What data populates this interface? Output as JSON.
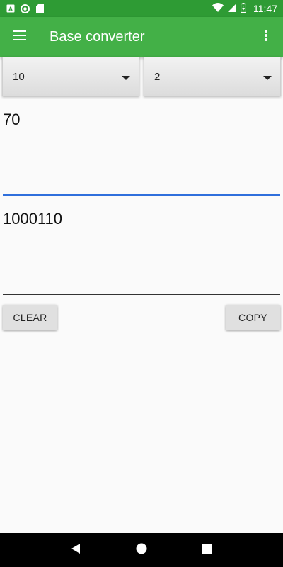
{
  "status_bar": {
    "time": "11:47",
    "left_icons": [
      "a-letter-icon",
      "circle-icon",
      "sd-card-icon"
    ],
    "right_icons": [
      "wifi-icon",
      "cell-signal-icon",
      "battery-icon"
    ]
  },
  "app_bar": {
    "title": "Base converter",
    "menu_icon": "hamburger-icon",
    "overflow_icon": "more-vert-icon"
  },
  "spinners": {
    "from_base": "10",
    "to_base": "2"
  },
  "fields": {
    "input_value": "70",
    "output_value": "1000110"
  },
  "buttons": {
    "clear_label": "CLEAR",
    "copy_label": "COPY"
  },
  "colors": {
    "status_bar": "#2e9b34",
    "app_bar": "#43b047",
    "input_underline": "#2f6fdc"
  }
}
